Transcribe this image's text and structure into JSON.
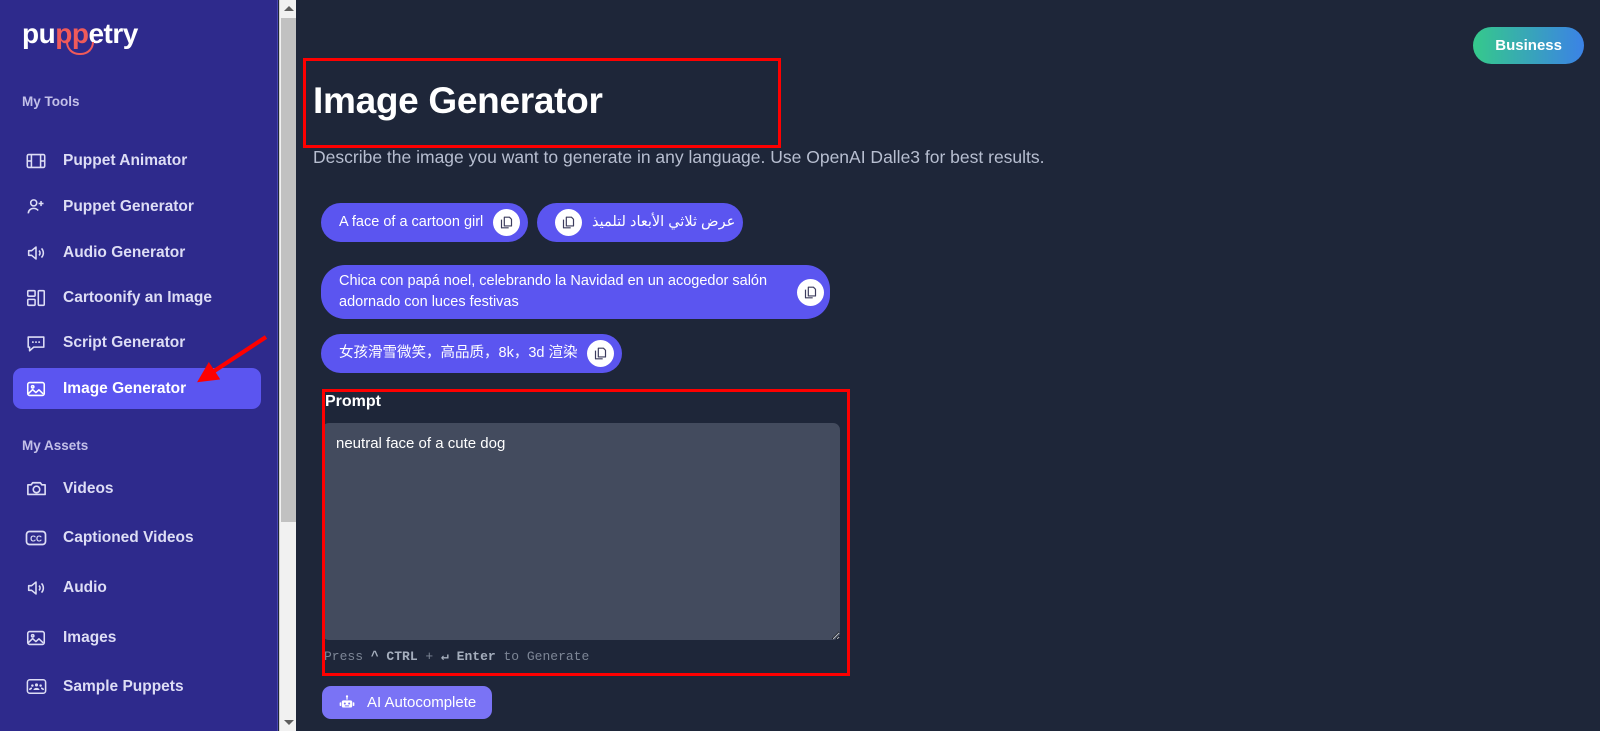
{
  "brand": {
    "name": "puppetry",
    "name_prefix": "pu",
    "name_accent": "pp",
    "name_suffix": "etry",
    "accent_color": "#f05a5a"
  },
  "sidebar": {
    "sections": [
      {
        "label": "My Tools"
      },
      {
        "label": "My Assets"
      }
    ],
    "tools": [
      {
        "label": "Puppet Animator",
        "icon": "film-strip-icon",
        "active": false
      },
      {
        "label": "Puppet Generator",
        "icon": "user-plus-icon",
        "active": false
      },
      {
        "label": "Audio Generator",
        "icon": "speaker-icon",
        "active": false
      },
      {
        "label": "Cartoonify an Image",
        "icon": "layout-blocks-icon",
        "active": false
      },
      {
        "label": "Script Generator",
        "icon": "chat-bubble-icon",
        "active": false
      },
      {
        "label": "Image Generator",
        "icon": "image-icon",
        "active": true
      }
    ],
    "assets": [
      {
        "label": "Videos",
        "icon": "camera-icon"
      },
      {
        "label": "Captioned Videos",
        "icon": "cc-icon"
      },
      {
        "label": "Audio",
        "icon": "speaker-icon"
      },
      {
        "label": "Images",
        "icon": "image-icon"
      },
      {
        "label": "Sample Puppets",
        "icon": "people-card-icon"
      }
    ],
    "scrollbar": {
      "up_arrow": "scroll-up-arrow",
      "down_arrow": "scroll-down-arrow"
    }
  },
  "header": {
    "plan_badge": "Business",
    "plan_badge_gradient_from": "#35c98b",
    "plan_badge_gradient_to": "#3b82e6"
  },
  "main": {
    "title": "Image Generator",
    "subtitle": "Describe the image you want to generate in any language. Use OpenAI Dalle3 for best results.",
    "suggestions": [
      {
        "text": "A face of a cartoon girl",
        "dir": "ltr",
        "copy_icon": "copy-icon"
      },
      {
        "text": "عرض ثلاثي الأبعاد لتلميذ",
        "dir": "rtl",
        "copy_icon": "copy-icon"
      },
      {
        "text": "Chica con papá noel, celebrando la Navidad en un acogedor salón adornado con luces festivas",
        "dir": "ltr",
        "copy_icon": "copy-icon"
      },
      {
        "text": "女孩滑雪微笑，高品质，8k，3d 渲染",
        "dir": "ltr",
        "copy_icon": "copy-icon"
      }
    ],
    "prompt": {
      "label": "Prompt",
      "value": "neutral face of a cute dog",
      "placeholder": "",
      "hint_prefix": "Press ",
      "hint_ctrl": "^ CTRL",
      "hint_plus": " + ",
      "hint_enter": "↵ Enter",
      "hint_suffix": " to Generate"
    },
    "autocomplete_button": {
      "label": "AI Autocomplete",
      "icon": "robot-icon"
    }
  },
  "annotations": {
    "title_box": "highlight-box-title",
    "prompt_box": "highlight-box-prompt",
    "arrow": "pointer-arrow",
    "color": "#fe0000"
  }
}
